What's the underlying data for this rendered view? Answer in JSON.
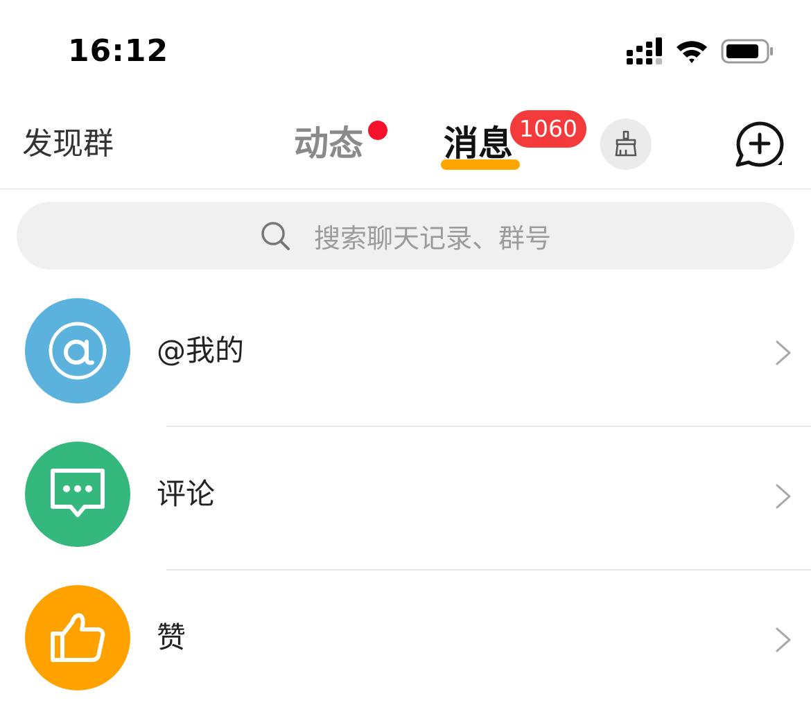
{
  "status_bar": {
    "time": "16:12"
  },
  "nav": {
    "discover_groups": "发现群",
    "tab_dynamic": "动态",
    "tab_messages": "消息",
    "messages_badge": "1060"
  },
  "search": {
    "placeholder": "搜索聊天记录、群号"
  },
  "list": [
    {
      "label": "@我的",
      "icon": "at-icon",
      "color": "#5ab2dd"
    },
    {
      "label": "评论",
      "icon": "comment-icon",
      "color": "#35b87e"
    },
    {
      "label": "赞",
      "icon": "thumbs-up-icon",
      "color": "#ffa200"
    }
  ]
}
